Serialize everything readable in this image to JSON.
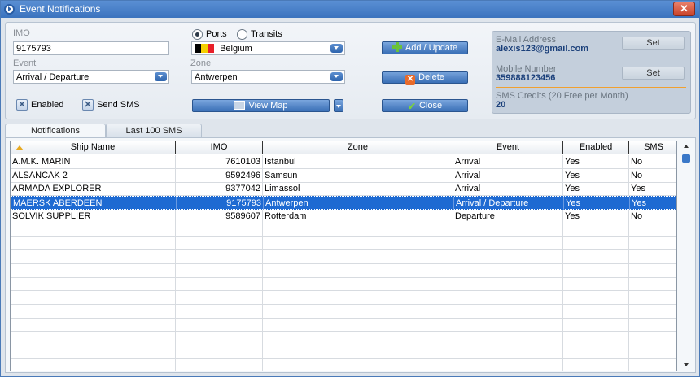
{
  "window": {
    "title": "Event Notifications",
    "close_label": "✕"
  },
  "form": {
    "imo_label": "IMO",
    "imo_value": "9175793",
    "event_label": "Event",
    "event_value": "Arrival / Departure",
    "zone_label": "Zone",
    "zone_value": "Antwerpen",
    "country_value": "Belgium",
    "country_flag_colors": [
      "#000000",
      "#f5d000",
      "#e8202a"
    ],
    "ports_label": "Ports",
    "transits_label": "Transits",
    "ports_selected": true,
    "enabled_label": "Enabled",
    "enabled_checked": true,
    "send_sms_label": "Send SMS",
    "send_sms_checked": true,
    "view_map_label": "View Map"
  },
  "actions": {
    "add_update_label": "Add / Update",
    "delete_label": "Delete",
    "close_label": "Close"
  },
  "account": {
    "email_label": "E-Mail Address",
    "email_value": "alexis123@gmail.com",
    "mobile_label": "Mobile Number",
    "mobile_value": "359888123456",
    "credits_label": "SMS Credits (20 Free per Month)",
    "credits_value": "20",
    "set_label": "Set"
  },
  "tabs": [
    {
      "label": "Notifications",
      "active": true
    },
    {
      "label": "Last 100 SMS",
      "active": false
    }
  ],
  "table": {
    "columns": [
      "Ship Name",
      "IMO",
      "Zone",
      "Event",
      "Enabled",
      "SMS"
    ],
    "rows": [
      {
        "ship": "A.M.K. MARIN",
        "imo": "7610103",
        "zone": "Istanbul",
        "event": "Arrival",
        "enabled": "Yes",
        "sms": "No",
        "selected": false
      },
      {
        "ship": "ALSANCAK 2",
        "imo": "9592496",
        "zone": "Samsun",
        "event": "Arrival",
        "enabled": "Yes",
        "sms": "No",
        "selected": false
      },
      {
        "ship": "ARMADA EXPLORER",
        "imo": "9377042",
        "zone": "Limassol",
        "event": "Arrival",
        "enabled": "Yes",
        "sms": "Yes",
        "selected": false
      },
      {
        "ship": "MAERSK ABERDEEN",
        "imo": "9175793",
        "zone": "Antwerpen",
        "event": "Arrival / Departure",
        "enabled": "Yes",
        "sms": "Yes",
        "selected": true
      },
      {
        "ship": "SOLVIK SUPPLIER",
        "imo": "9589607",
        "zone": "Rotterdam",
        "event": "Departure",
        "enabled": "Yes",
        "sms": "No",
        "selected": false
      }
    ]
  },
  "colors": {
    "accent": "#3b73be",
    "selection": "#1e6ad2",
    "separator": "#f0a030"
  }
}
